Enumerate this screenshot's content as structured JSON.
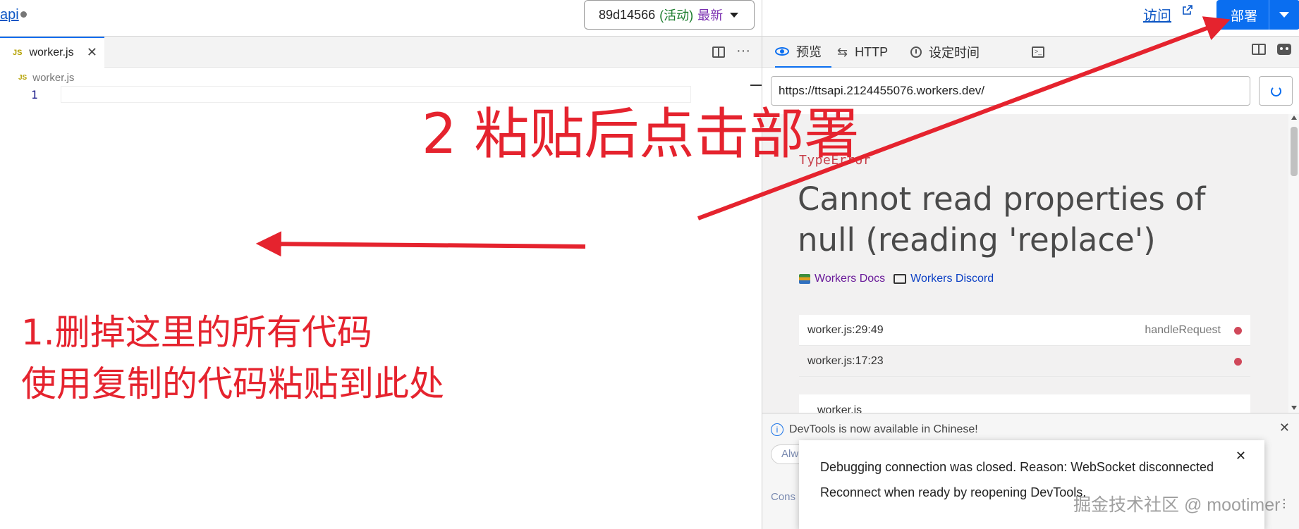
{
  "topbar": {
    "breadcrumb": "api",
    "version": {
      "hash": "89d14566",
      "status": "(活动)",
      "latest": "最新"
    },
    "visit_label": "访问",
    "deploy_label": "部署"
  },
  "editor": {
    "tab_label": "worker.js",
    "file_badge": "JS",
    "breadcrumb_file": "worker.js",
    "line_number": "1"
  },
  "preview": {
    "tabs": [
      {
        "label": "预览",
        "icon": "eye-icon",
        "active": true
      },
      {
        "label": "HTTP",
        "icon": "swap-arrows-icon",
        "active": false
      },
      {
        "label": "设定时间",
        "icon": "clock-icon",
        "active": false
      },
      {
        "label": "",
        "icon": "terminal-icon",
        "active": false
      }
    ],
    "url": "https://ttsapi.2124455076.workers.dev/",
    "error": {
      "type": "TypeError",
      "message": "Cannot read properties of null (reading 'replace')",
      "links": {
        "docs": "Workers Docs",
        "discord": "Workers Discord"
      },
      "stack": [
        {
          "location": "worker.js:29:49",
          "function": "handleRequest"
        },
        {
          "location": "worker.js:17:23",
          "function": ""
        }
      ],
      "code_file": "worker.js"
    }
  },
  "devtools": {
    "banner": "DevTools is now available in Chinese!",
    "always_btn": "Alw",
    "console_tab": "Cons",
    "modal_line1": "Debugging connection was closed. Reason: WebSocket disconnected",
    "modal_line2": "Reconnect when ready by reopening DevTools."
  },
  "annotations": {
    "step2": "2 粘贴后点击部署",
    "step1_line1": "1.删掉这里的所有代码",
    "step1_line2": "使用复制的代码粘贴到此处"
  },
  "watermark": "掘金技术社区 @ mootimer",
  "colors": {
    "accent": "#0a6ef0",
    "annotation": "#e5232e",
    "error": "#c63d48"
  }
}
